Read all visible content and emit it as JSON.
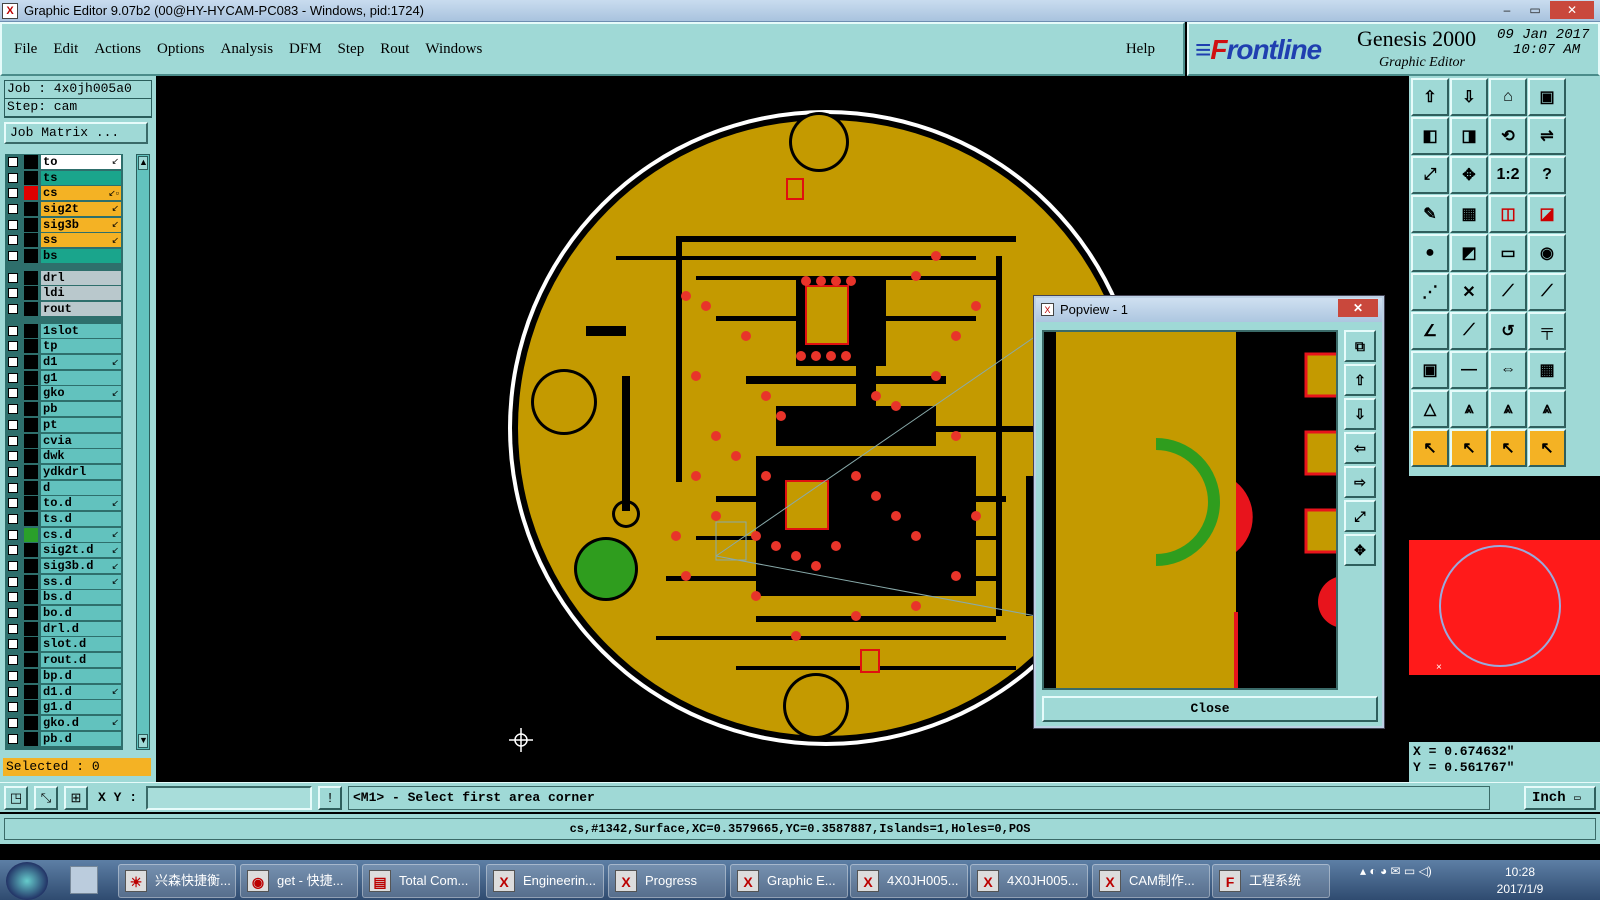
{
  "window": {
    "title": "Graphic Editor 9.07b2 (00@HY-HYCAM-PC083 - Windows, pid:1724)",
    "min": "–",
    "max": "▭",
    "close": "✕"
  },
  "menu": {
    "items": [
      "File",
      "Edit",
      "Actions",
      "Options",
      "Analysis",
      "DFM",
      "Step",
      "Rout",
      "Windows"
    ],
    "help": "Help"
  },
  "brand": {
    "logo_first": "F",
    "logo_rest": "rontline",
    "product": "Genesis 2000",
    "subtitle": "Graphic Editor",
    "date": "09 Jan 2017",
    "time": "10:07 AM"
  },
  "job": {
    "job_line": "Job : 4x0jh005a0",
    "step_line": "Step: cam",
    "matrix_button": "Job Matrix ..."
  },
  "layers_group1": [
    {
      "name": "to",
      "color": "#ffffff",
      "swatch": "#000000",
      "arrow": "↙"
    },
    {
      "name": "ts",
      "color": "#1aa58c",
      "swatch": "#000000",
      "arrow": ""
    },
    {
      "name": "cs",
      "color": "#f4b224",
      "swatch": "#e00000",
      "arrow": "↙▫",
      "active": true
    },
    {
      "name": "sig2t",
      "color": "#f4b224",
      "swatch": "#000000",
      "arrow": "↙"
    },
    {
      "name": "sig3b",
      "color": "#f4b224",
      "swatch": "#000000",
      "arrow": "↙"
    },
    {
      "name": "ss",
      "color": "#f4b224",
      "swatch": "#000000",
      "arrow": "↙"
    },
    {
      "name": "bs",
      "color": "#1aa58c",
      "swatch": "#000000",
      "arrow": ""
    }
  ],
  "layers_group2": [
    {
      "name": "drl",
      "color": "#b9c8cc",
      "swatch": "#000000",
      "arrow": ""
    },
    {
      "name": "ldi",
      "color": "#b9c8cc",
      "swatch": "#000000",
      "arrow": ""
    },
    {
      "name": "rout",
      "color": "#b9c8cc",
      "swatch": "#000000",
      "arrow": ""
    }
  ],
  "layers_group3": [
    {
      "name": "1slot",
      "arrow": ""
    },
    {
      "name": "tp",
      "arrow": ""
    },
    {
      "name": "d1",
      "arrow": "↙"
    },
    {
      "name": "g1",
      "arrow": ""
    },
    {
      "name": "gko",
      "arrow": "↙"
    },
    {
      "name": "pb",
      "arrow": ""
    },
    {
      "name": "pt",
      "arrow": ""
    },
    {
      "name": "cvia",
      "arrow": ""
    },
    {
      "name": "dwk",
      "arrow": ""
    },
    {
      "name": "ydkdrl",
      "arrow": ""
    },
    {
      "name": "d",
      "arrow": ""
    },
    {
      "name": "to.d",
      "arrow": "↙"
    },
    {
      "name": "ts.d",
      "arrow": ""
    },
    {
      "name": "cs.d",
      "arrow": "↙",
      "mark": "#2aa02a"
    },
    {
      "name": "sig2t.d",
      "arrow": "↙"
    },
    {
      "name": "sig3b.d",
      "arrow": "↙"
    },
    {
      "name": "ss.d",
      "arrow": "↙"
    },
    {
      "name": "bs.d",
      "arrow": ""
    },
    {
      "name": "bo.d",
      "arrow": ""
    },
    {
      "name": "drl.d",
      "arrow": ""
    },
    {
      "name": "slot.d",
      "arrow": ""
    },
    {
      "name": "rout.d",
      "arrow": ""
    },
    {
      "name": "bp.d",
      "arrow": ""
    },
    {
      "name": "d1.d",
      "arrow": "↙"
    },
    {
      "name": "g1.d",
      "arrow": ""
    },
    {
      "name": "gko.d",
      "arrow": "↙"
    },
    {
      "name": "pb.d",
      "arrow": ""
    }
  ],
  "selected": "Selected : 0",
  "coords": {
    "x": "X = 0.674632\"",
    "y": "Y = 0.561767\""
  },
  "command": {
    "xy_label": "X Y :",
    "xy_value": "",
    "info_icon": "!",
    "prompt": "<M1> - Select first area corner",
    "units": "Inch"
  },
  "status_line": "cs,#1342,Surface,XC=0.3579665,YC=0.3587887,Islands=1,Holes=0,POS",
  "popview": {
    "title": "Popview - 1",
    "close_label": "Close",
    "close_x": "✕"
  },
  "right_tools": [
    "⇧",
    "⇩",
    "⌂",
    "▣",
    "◧",
    "◨",
    "⟲",
    "⇌",
    "⤢",
    "✥",
    "1:2",
    "?",
    "✎",
    "▦",
    "◫",
    "◪",
    "●",
    "◩",
    "▭",
    "◉",
    "⋰",
    "✕",
    "⟋",
    "⟋",
    "∠",
    "⟋",
    "↺",
    "╤",
    "▣",
    "—",
    "⇔",
    "▦",
    "△",
    "⩓",
    "⩓",
    "⩓",
    "↖",
    "↖",
    "↖",
    "↖"
  ],
  "taskbar": {
    "tasks": [
      {
        "label": "兴森快捷衡...",
        "icon": "☀"
      },
      {
        "label": "get - 快捷...",
        "icon": "◉"
      },
      {
        "label": "Total Com...",
        "icon": "▤"
      },
      {
        "label": "Engineerin...",
        "icon": "X"
      },
      {
        "label": "Progress",
        "icon": "X"
      },
      {
        "label": "Graphic E...",
        "icon": "X"
      },
      {
        "label": "4X0JH005...",
        "icon": "X"
      },
      {
        "label": "4X0JH005...",
        "icon": "X"
      },
      {
        "label": "CAM制作...",
        "icon": "X"
      },
      {
        "label": "工程系统",
        "icon": "F"
      }
    ],
    "tray": "▴  ◐  ◕  ✉  ▭  ◁)",
    "time": "10:28",
    "date": "2017/1/9"
  }
}
